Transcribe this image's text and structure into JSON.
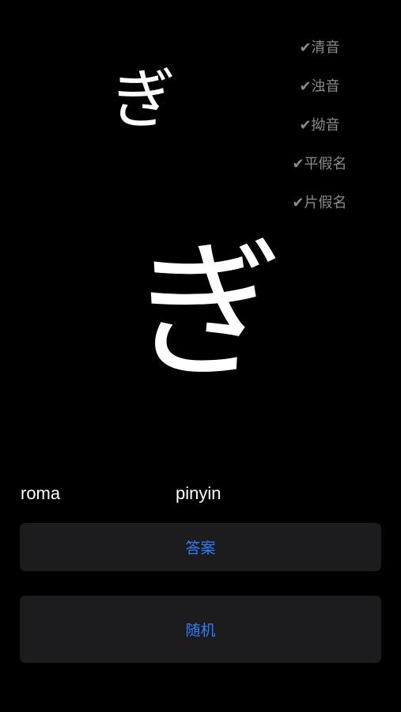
{
  "kana": {
    "small": "ぎ",
    "large": "ぎ"
  },
  "options": [
    {
      "label": "✔清音"
    },
    {
      "label": "✔浊音"
    },
    {
      "label": "✔拗音"
    },
    {
      "label": "✔平假名"
    },
    {
      "label": "✔片假名"
    }
  ],
  "readings": {
    "roma": "roma",
    "pinyin": "pinyin"
  },
  "buttons": {
    "answer": "答案",
    "random": "随机"
  },
  "colors": {
    "background": "#000000",
    "accent": "#2f7cf6",
    "button_bg": "#1c1c1e",
    "option_text": "#8a8a8a"
  }
}
